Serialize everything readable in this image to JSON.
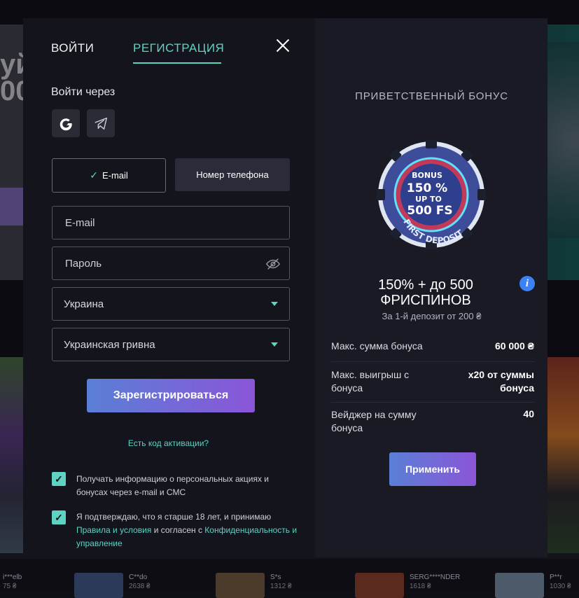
{
  "tabs": {
    "login": "ВОЙТИ",
    "register": "РЕГИСТРАЦИЯ"
  },
  "social": {
    "label": "Войти через",
    "icons": [
      "google-icon",
      "telegram-icon"
    ]
  },
  "method": {
    "email": "E-mail",
    "phone": "Номер телефона",
    "selected": "email"
  },
  "form": {
    "email_placeholder": "E-mail",
    "password_placeholder": "Пароль",
    "country": "Украина",
    "currency": "Украинская гривна"
  },
  "register_button": "Зарегистрироваться",
  "promo_link": "Есть код активации?",
  "consent": {
    "marketing": "Получать информацию о персональных акциях и бонусах через e-mail и СМС",
    "age_prefix": "Я подтверждаю, что я старше 18 лет, и принимаю ",
    "terms_link": "Правила и условия",
    "age_middle": " и согласен с ",
    "privacy_link": "Конфиденциальность и управление"
  },
  "bonus": {
    "heading": "ПРИВЕТСТВЕННЫЙ БОНУС",
    "chip_text": {
      "top": "BONUS",
      "pct": "150 %",
      "upto": "UP TO",
      "fs": "500 FS",
      "ring": "FIRST DEPOSIT"
    },
    "title": "150% + до 500 ФРИСПИНОВ",
    "subtitle": "За 1-й депозит от 200 ₴",
    "rows": [
      {
        "label": "Макс. сумма бонуса",
        "value": "60 000 ₴"
      },
      {
        "label": "Макс. выигрыш с бонуса",
        "value": "x20 от суммы бонуса"
      },
      {
        "label": "Вейджер на сумму бонуса",
        "value": "40"
      }
    ],
    "apply_button": "Применить"
  },
  "background": {
    "recent_wins": [
      {
        "user": "i***elb",
        "amount": "75 ₴"
      },
      {
        "user": "C**do",
        "amount": "2638 ₴"
      },
      {
        "user": "S*s",
        "amount": "1312 ₴"
      },
      {
        "user": "SERG****NDER",
        "amount": "1618 ₴"
      },
      {
        "user": "P**r",
        "amount": "1030 ₴"
      }
    ]
  },
  "colors": {
    "accent": "#5fd3c2",
    "button_from": "#5a7fd6",
    "button_to": "#8b55d8",
    "info": "#3b82f6"
  }
}
